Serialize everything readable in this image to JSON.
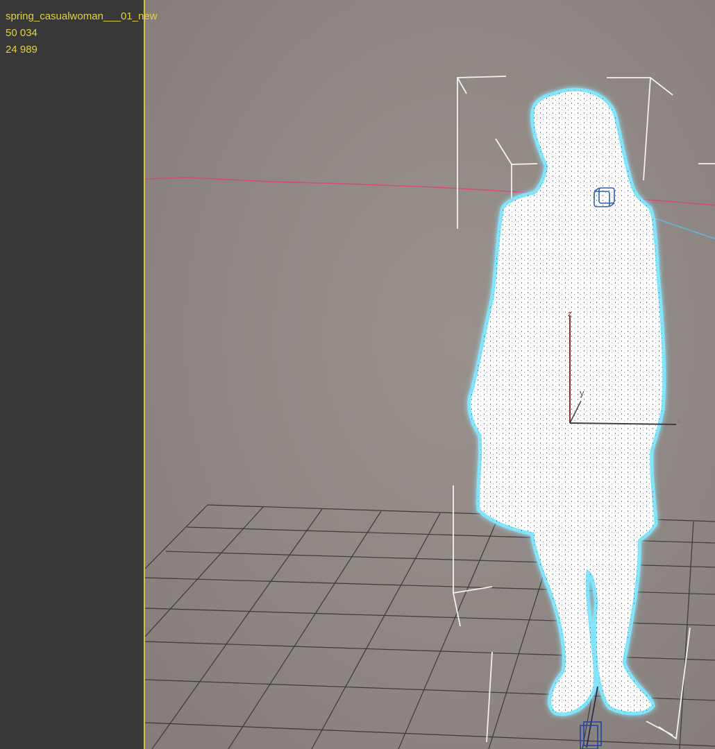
{
  "viewport": {
    "object_name": "spring_casualwoman___01_new",
    "vertex_count": "50 034",
    "face_count": "24 989",
    "axis_labels": {
      "x": "x",
      "y": "y",
      "z": "z"
    }
  },
  "colors": {
    "stats_text": "#e6d23a",
    "viewport_border": "#d8c332",
    "selection_glow": "#7fe6ff",
    "axis_x": "#404040",
    "axis_z": "#8a2a2a",
    "horizon_line": "#d6477a",
    "camera_line": "#5fb8e6"
  },
  "icons": {
    "pivot": "pivot-cube-icon",
    "base": "base-cube-icon"
  }
}
